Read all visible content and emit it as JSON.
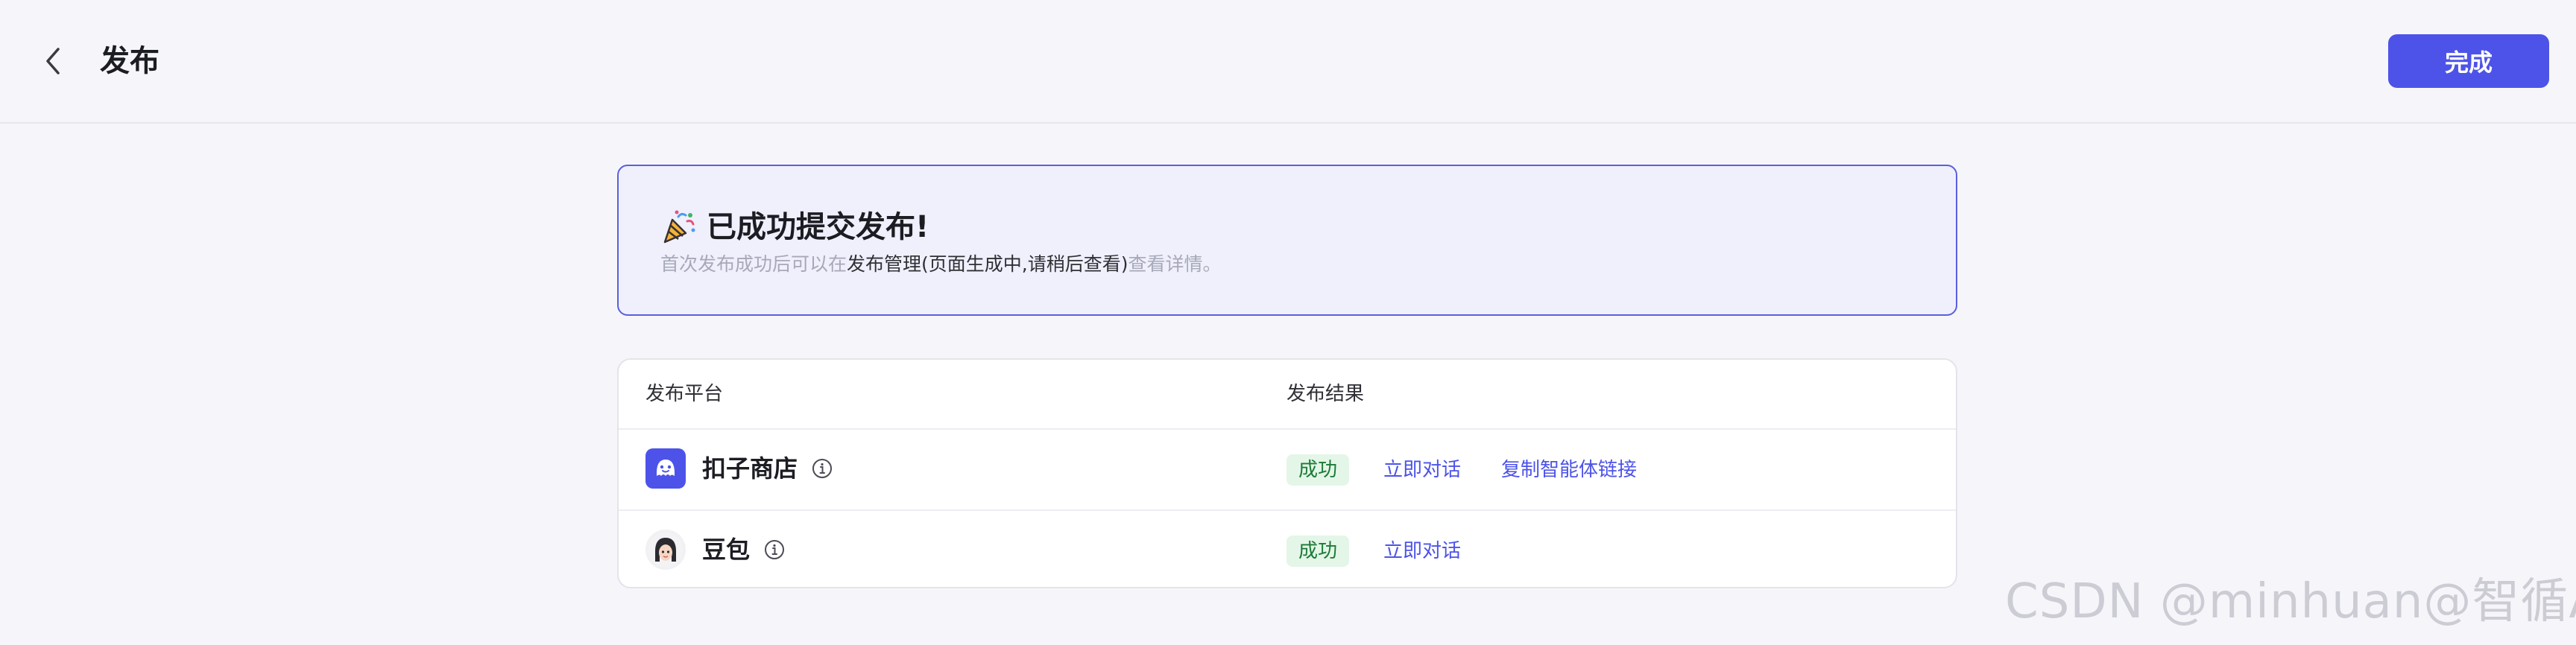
{
  "header": {
    "title": "发布",
    "done_label": "完成"
  },
  "success": {
    "title": "已成功提交发布!",
    "desc_prefix": "首次发布成功后可以在",
    "desc_link": "发布管理(页面生成中,请稍后查看)",
    "desc_suffix": "查看详情。"
  },
  "table": {
    "columns": [
      "发布平台",
      "发布结果"
    ],
    "rows": [
      {
        "platform": "扣子商店",
        "status": "成功",
        "actions": [
          "立即对话",
          "复制智能体链接"
        ]
      },
      {
        "platform": "豆包",
        "status": "成功",
        "actions": [
          "立即对话"
        ]
      }
    ]
  },
  "colors": {
    "accent": "#4d53e8",
    "success_bg": "#e3f6e7",
    "success_text": "#1d7a37",
    "card_border": "#5a5fe0"
  },
  "watermark": "CSDN @minhuan@智循AI"
}
